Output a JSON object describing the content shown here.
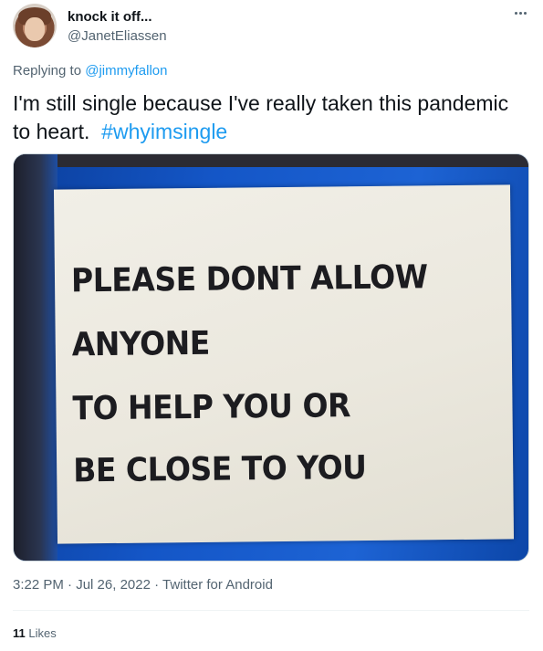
{
  "author": {
    "display_name": "knock it off...",
    "handle": "@JanetEliassen"
  },
  "reply": {
    "prefix": "Replying to ",
    "to_handle": "@jimmyfallon"
  },
  "tweet": {
    "text": "I'm still single because I've really taken this pandemic to heart.",
    "hashtag": "#whyimsingle"
  },
  "media": {
    "sign_lines": [
      "PLEASE DONT ALLOW",
      "ANYONE",
      "TO HELP YOU OR",
      "BE CLOSE TO YOU"
    ]
  },
  "meta": {
    "time": "3:22 PM",
    "date": "Jul 26, 2022",
    "source": "Twitter for Android",
    "separator": "·"
  },
  "engagement": {
    "likes_count": "11",
    "likes_label": "Likes"
  },
  "icons": {
    "more": "more-options-icon"
  },
  "colors": {
    "link": "#1d9bf0",
    "secondary_text": "#536471",
    "primary_text": "#0f1419"
  }
}
